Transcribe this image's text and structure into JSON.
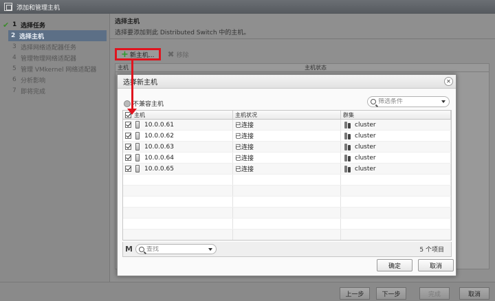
{
  "window": {
    "title": "添加和管理主机"
  },
  "steps": [
    {
      "num": "1",
      "label": "选择任务",
      "state": "done"
    },
    {
      "num": "2",
      "label": "选择主机",
      "state": "current"
    },
    {
      "num": "3",
      "label": "选择网络适配器任务",
      "state": "pending"
    },
    {
      "num": "4",
      "label": "管理物理网络适配器",
      "state": "pending"
    },
    {
      "num": "5",
      "label": "管理 VMkernel 网络适配器",
      "state": "pending"
    },
    {
      "num": "6",
      "label": "分析影响",
      "state": "pending"
    },
    {
      "num": "7",
      "label": "即将完成",
      "state": "pending"
    }
  ],
  "main": {
    "heading": "选择主机",
    "description": "选择要添加到此 Distributed Switch 中的主机。",
    "new_host_label": "新主机...",
    "remove_label": "移除",
    "bg_columns": [
      "主机",
      "主机状态"
    ]
  },
  "dialog": {
    "title": "选择新主机",
    "only_new_label": "不兼容主机",
    "filter_placeholder": "筛选条件",
    "columns": [
      "主机",
      "主机状况",
      "群集"
    ],
    "hosts": [
      {
        "name": "10.0.0.61",
        "status": "已连接",
        "cluster": "cluster",
        "checked": true
      },
      {
        "name": "10.0.0.62",
        "status": "已连接",
        "cluster": "cluster",
        "checked": true
      },
      {
        "name": "10.0.0.63",
        "status": "已连接",
        "cluster": "cluster",
        "checked": true
      },
      {
        "name": "10.0.0.64",
        "status": "已连接",
        "cluster": "cluster",
        "checked": true
      },
      {
        "name": "10.0.0.65",
        "status": "已连接",
        "cluster": "cluster",
        "checked": true
      }
    ],
    "search_placeholder": "查找",
    "item_count": "5 个项目",
    "ok_label": "确定",
    "cancel_label": "取消"
  },
  "footer": {
    "back": "上一步",
    "next": "下一步",
    "finish": "完成",
    "cancel": "取消"
  },
  "colors": {
    "highlight": "#e0141e",
    "current_step": "#5c6f86",
    "add_icon": "#2d9a2d"
  }
}
